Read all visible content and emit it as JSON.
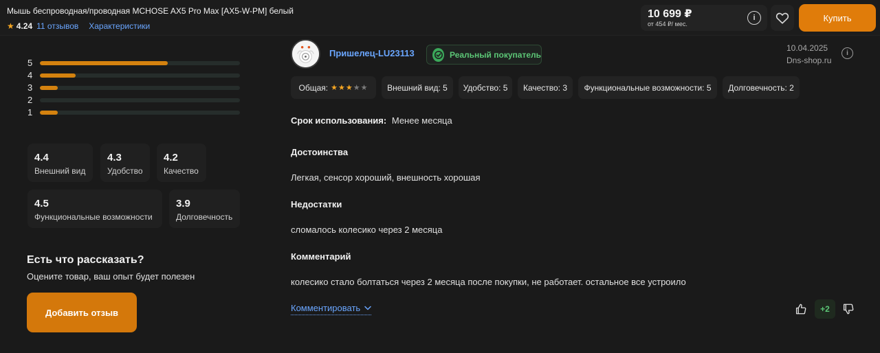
{
  "product": {
    "title": "Мышь беспроводная/проводная MCHOSE AX5 Pro Max [AX5-W-PM] белый",
    "rating": "4.24",
    "reviews_link": "11 отзывов",
    "specs_link": "Характеристики"
  },
  "price": {
    "main": "10 699 ₽",
    "monthly": "от 454 ₽/ мес."
  },
  "buy_label": "Купить",
  "distribution": [
    {
      "stars": "5",
      "fraction": 0.64
    },
    {
      "stars": "4",
      "fraction": 0.18
    },
    {
      "stars": "3",
      "fraction": 0.09
    },
    {
      "stars": "2",
      "fraction": 0.0
    },
    {
      "stars": "1",
      "fraction": 0.09
    }
  ],
  "scores": [
    {
      "value": "4.4",
      "label": "Внешний вид"
    },
    {
      "value": "4.3",
      "label": "Удобство"
    },
    {
      "value": "4.2",
      "label": "Качество"
    },
    {
      "value": "4.5",
      "label": "Функциональные возможности"
    },
    {
      "value": "3.9",
      "label": "Долговечность"
    }
  ],
  "cta": {
    "title": "Есть что рассказать?",
    "text": "Оцените товар, ваш опыт будет полезен",
    "button": "Добавить отзыв"
  },
  "review": {
    "author": "Пришелец-LU23113",
    "badge": "Реальный покупатель",
    "date": "10.04.2025",
    "source": "Dns-shop.ru",
    "overall_label": "Общая:",
    "overall_stars": 3,
    "chips": [
      "Внешний вид: 5",
      "Удобство: 5",
      "Качество: 3",
      "Функциональные возможности: 5",
      "Долговечность: 2"
    ],
    "usage_label": "Срок использования:",
    "usage_value": "Менее месяца",
    "pros_title": "Достоинства",
    "pros_text": "Легкая, сенсор хороший, внешность хорошая",
    "cons_title": "Недостатки",
    "cons_text": "сломалось колесико через 2 месяца",
    "comment_title": "Комментарий",
    "comment_text": "колесико стало болтаться через 2 месяца после покупки, не работает. остальное все устроило",
    "comment_action": "Комментировать",
    "votes": "+2"
  },
  "colors": {
    "accent": "#e07c0a",
    "link": "#6aa6ff",
    "success": "#5cc676",
    "star": "#f5a623"
  }
}
